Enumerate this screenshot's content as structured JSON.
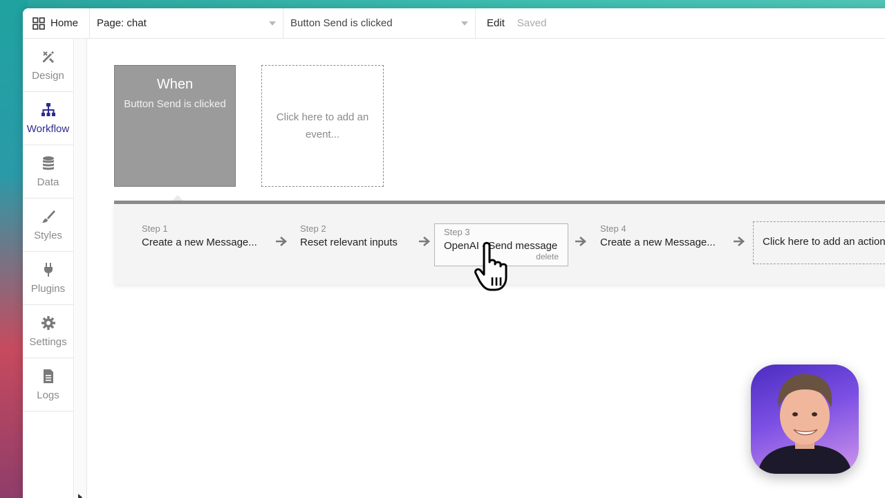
{
  "topbar": {
    "home_label": "Home",
    "page_selector": "Page: chat",
    "event_selector": "Button Send is clicked",
    "edit_label": "Edit",
    "saved_label": "Saved"
  },
  "sidebar": {
    "items": [
      {
        "label": "Design",
        "icon": "design-icon"
      },
      {
        "label": "Workflow",
        "icon": "workflow-icon",
        "active": true
      },
      {
        "label": "Data",
        "icon": "database-icon"
      },
      {
        "label": "Styles",
        "icon": "brush-icon"
      },
      {
        "label": "Plugins",
        "icon": "plug-icon"
      },
      {
        "label": "Settings",
        "icon": "gear-icon"
      },
      {
        "label": "Logs",
        "icon": "document-icon"
      }
    ],
    "active_color": "#2c2b8f"
  },
  "canvas": {
    "event": {
      "title": "When",
      "subtitle": "Button Send is clicked"
    },
    "add_event_label": "Click here to add an event...",
    "steps": [
      {
        "label": "Step 1",
        "name": "Create a new Message..."
      },
      {
        "label": "Step 2",
        "name": "Reset relevant inputs"
      },
      {
        "label": "Step 3",
        "name": "OpenAI - Send message",
        "delete_label": "delete"
      },
      {
        "label": "Step 4",
        "name": "Create a new Message..."
      }
    ],
    "add_action_label": "Click here to add an action..."
  }
}
